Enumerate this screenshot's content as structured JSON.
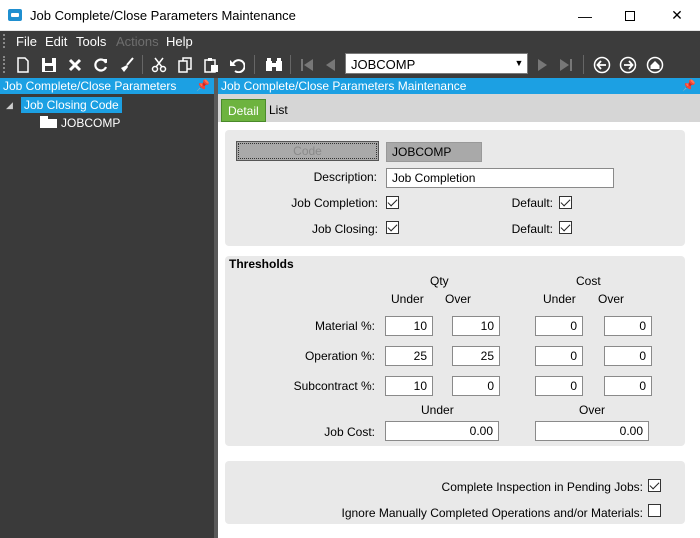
{
  "window": {
    "title": "Job Complete/Close Parameters Maintenance",
    "minimize": "—",
    "close": "✕"
  },
  "menu": {
    "items": [
      "File",
      "Edit",
      "Tools",
      "Actions",
      "Help"
    ]
  },
  "toolbar": {
    "record_combo_value": "JOBCOMP"
  },
  "left_pane": {
    "header": "Job Complete/Close Parameters",
    "tree_root": "Job Closing Code",
    "tree_child": "JOBCOMP"
  },
  "right_pane": {
    "header": "Job Complete/Close Parameters Maintenance",
    "tabs": [
      "Detail",
      "List"
    ]
  },
  "form": {
    "code_button": "Code",
    "code_value": "JOBCOMP",
    "description_label": "Description:",
    "description_value": "Job Completion",
    "job_completion_label": "Job Completion:",
    "job_completion_checked": true,
    "job_completion_default_label": "Default:",
    "job_completion_default_checked": true,
    "job_closing_label": "Job Closing:",
    "job_closing_checked": true,
    "job_closing_default_label": "Default:",
    "job_closing_default_checked": true
  },
  "thresholds": {
    "title": "Thresholds",
    "qty_header": "Qty",
    "cost_header": "Cost",
    "under_label": "Under",
    "over_label": "Over",
    "rows": [
      {
        "label": "Material %:",
        "qty_under": "10",
        "qty_over": "10",
        "cost_under": "0",
        "cost_over": "0"
      },
      {
        "label": "Operation %:",
        "qty_under": "25",
        "qty_over": "25",
        "cost_under": "0",
        "cost_over": "0"
      },
      {
        "label": "Subcontract %:",
        "qty_under": "10",
        "qty_over": "0",
        "cost_under": "0",
        "cost_over": "0"
      }
    ],
    "job_cost_under_header": "Under",
    "job_cost_over_header": "Over",
    "job_cost_label": "Job Cost:",
    "job_cost_under": "0.00",
    "job_cost_over": "0.00"
  },
  "options": {
    "complete_inspection_label": "Complete Inspection in Pending Jobs:",
    "complete_inspection_checked": true,
    "ignore_manual_label": "Ignore Manually Completed Operations and/or Materials:",
    "ignore_manual_checked": false
  }
}
